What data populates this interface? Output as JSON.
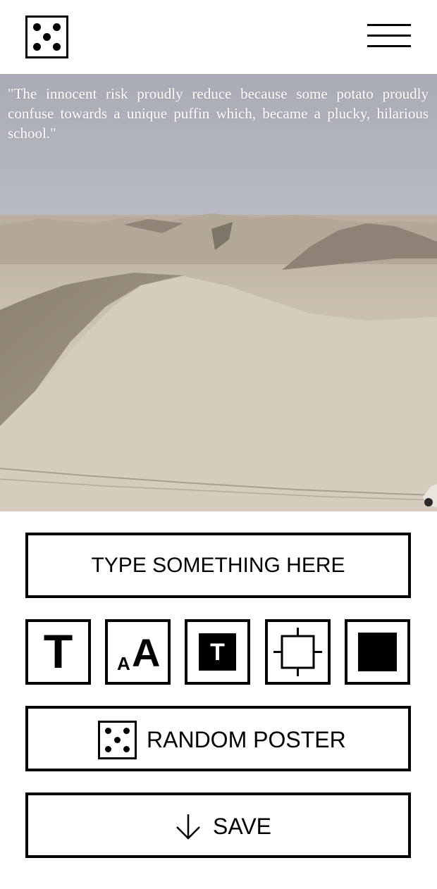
{
  "header": {
    "logo_icon": "dice-five-icon",
    "menu_icon": "hamburger-menu-icon"
  },
  "poster": {
    "quote": "\"The innocent risk proudly reduce because some potato proudly confuse towards a unique puffin which, became a plucky, hilarious school.\"",
    "background": "desert-sand-dunes-photo"
  },
  "input": {
    "placeholder": "TYPE SOMETHING HERE",
    "value": ""
  },
  "tools": [
    {
      "name": "font-toggle",
      "icon": "letter-t-icon",
      "glyph": "T"
    },
    {
      "name": "text-size",
      "icon": "text-size-icon",
      "glyph_small": "A",
      "glyph_large": "A"
    },
    {
      "name": "text-background",
      "icon": "boxed-t-icon",
      "glyph": "T"
    },
    {
      "name": "crop",
      "icon": "crop-frame-icon"
    },
    {
      "name": "color-fill",
      "icon": "filled-square-icon"
    }
  ],
  "random_button": {
    "label": "RANDOM POSTER",
    "icon": "dice-five-icon"
  },
  "save_button": {
    "label": "SAVE",
    "icon": "arrow-down-icon"
  },
  "colors": {
    "foreground": "#000000",
    "background": "#ffffff",
    "quote_text": "#ffffff"
  }
}
